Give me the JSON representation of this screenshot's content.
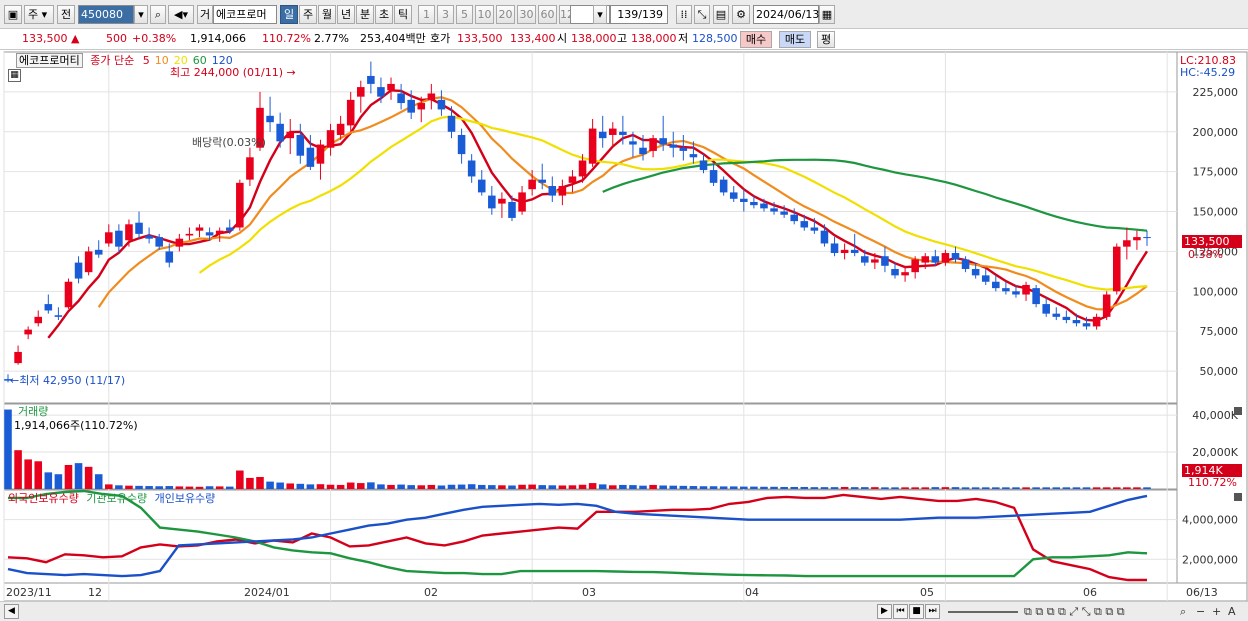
{
  "toolbar": {
    "market_label": "주",
    "period_label": "전",
    "code": "450080",
    "name_btn": "거",
    "stock_name": "에코프로머",
    "period_tabs": [
      "일",
      "주",
      "월",
      "년",
      "분",
      "초",
      "틱"
    ],
    "selected_tab": "일",
    "interval_buttons": [
      "1",
      "3",
      "5",
      "10",
      "20",
      "30",
      "60",
      "120"
    ],
    "count_value": "139/139",
    "date_value": "2024/06/13"
  },
  "quote": {
    "price": "133,500",
    "change": "500",
    "change_pct": "+0.38%",
    "volume": "1,914,066",
    "volume_ratio": "110.72%",
    "turnover_pct": "2.77%",
    "amount": "253,404백만",
    "bid_label": "호가",
    "ask": "133,500",
    "bid": "133,400",
    "open_label": "시",
    "open": "138,000",
    "high_label": "고",
    "high": "138,000",
    "low_label": "저",
    "low": "128,500",
    "buy_btn": "매수",
    "sell_btn": "매도",
    "eval_btn": "평"
  },
  "legend": {
    "stock_name": "에코프로머티",
    "ma_label": "종가 단순",
    "ma_periods": [
      "5",
      "10",
      "20",
      "60",
      "120"
    ],
    "ma_colors": [
      "#d4001a",
      "#f08c1e",
      "#f0e000",
      "#1e9640",
      "#1a50c8"
    ],
    "high_annot": "최고 244,000 (01/11)",
    "low_annot": "최저 42,950 (11/17)",
    "div_annot": "배당락(0.03%)",
    "lc_label": "LC:210.83",
    "hc_label": "HC:-45.29",
    "last_price_tag": "133,500",
    "last_pct_tag": "0.38%",
    "volume_title": "거래량",
    "volume_annot": "1,914,066주(110.72%)",
    "volume_tag": "1,914K",
    "volume_pct_tag": "110.72%",
    "holding_series": [
      "외국인보유수량",
      "기관보유수량",
      "개인보유수량"
    ]
  },
  "chart_data": [
    {
      "type": "candlestick",
      "title": "에코프로머티",
      "yticks": [
        50000,
        75000,
        100000,
        125000,
        150000,
        175000,
        200000,
        225000
      ],
      "ylim": [
        30000,
        250000
      ],
      "xticks": [
        "2023/11",
        "12",
        "2024/01",
        "02",
        "03",
        "04",
        "05",
        "06",
        "06/13"
      ],
      "grid": true,
      "price_ohlc_1": [
        [
          45000,
          48000,
          42950,
          44000
        ],
        [
          55000,
          66000,
          54000,
          62000
        ],
        [
          73000,
          78000,
          70000,
          76000
        ],
        [
          80000,
          88000,
          78000,
          84000
        ],
        [
          92000,
          98000,
          86000,
          88000
        ],
        [
          85000,
          90000,
          82000,
          84000
        ],
        [
          90000,
          108000,
          89000,
          106000
        ],
        [
          118000,
          122000,
          105000,
          108000
        ],
        [
          112000,
          128000,
          110000,
          125000
        ],
        [
          126000,
          132000,
          121000,
          123000
        ],
        [
          130000,
          142000,
          128000,
          137000
        ],
        [
          138000,
          142000,
          124000,
          128000
        ],
        [
          132000,
          145000,
          128000,
          142000
        ],
        [
          143000,
          150000,
          133000,
          136000
        ],
        [
          135000,
          140000,
          130000,
          133000
        ],
        [
          134000,
          136000,
          126000,
          128000
        ],
        [
          125000,
          130000,
          115000,
          118000
        ],
        [
          128000,
          136000,
          125000,
          133000
        ],
        [
          135000,
          140000,
          132000,
          136000
        ],
        [
          138000,
          142000,
          134000,
          140000
        ],
        [
          137000,
          140000,
          132000,
          135000
        ],
        [
          136000,
          140000,
          131000,
          138000
        ],
        [
          140000,
          145000,
          136000,
          138000
        ],
        [
          140000,
          170000,
          138000,
          168000
        ],
        [
          170000,
          190000,
          166000,
          184000
        ],
        [
          190000,
          225000,
          188000,
          215000
        ],
        [
          210000,
          222000,
          200000,
          206000
        ],
        [
          205000,
          212000,
          190000,
          194000
        ],
        [
          196000,
          208000,
          186000,
          200000
        ],
        [
          198000,
          205000,
          180000,
          185000
        ],
        [
          190000,
          198000,
          176000,
          178000
        ],
        [
          180000,
          195000,
          170000,
          192000
        ],
        [
          190000,
          205000,
          185000,
          201000
        ],
        [
          198000,
          210000,
          195000,
          205000
        ],
        [
          204000,
          225000,
          200000,
          220000
        ],
        [
          222000,
          232000,
          212000,
          228000
        ],
        [
          235000,
          244000,
          224000,
          230000
        ],
        [
          228000,
          234000,
          218000,
          222000
        ],
        [
          226000,
          234000,
          220000,
          230000
        ],
        [
          224000,
          230000,
          214000,
          218000
        ],
        [
          220000,
          226000,
          208000,
          212000
        ],
        [
          214000,
          222000,
          206000,
          218000
        ],
        [
          220000,
          230000,
          214000,
          224000
        ],
        [
          220000,
          226000,
          210000,
          214000
        ],
        [
          210000,
          216000,
          196000,
          200000
        ],
        [
          198000,
          202000,
          180000,
          186000
        ],
        [
          182000,
          186000,
          168000,
          172000
        ],
        [
          170000,
          176000,
          160000,
          162000
        ],
        [
          160000,
          166000,
          148000,
          152000
        ],
        [
          155000,
          162000,
          146000,
          158000
        ],
        [
          156000,
          160000,
          144000,
          146000
        ],
        [
          150000,
          166000,
          148000,
          162000
        ],
        [
          164000,
          176000,
          160000,
          170000
        ],
        [
          170000,
          180000,
          164000,
          168000
        ],
        [
          166000,
          172000,
          156000,
          160000
        ],
        [
          160000,
          170000,
          154000,
          166000
        ],
        [
          168000,
          176000,
          162000,
          172000
        ],
        [
          172000,
          186000,
          168000,
          182000
        ],
        [
          180000,
          208000,
          178000,
          202000
        ],
        [
          200000,
          210000,
          190000,
          196000
        ],
        [
          198000,
          206000,
          190000,
          202000
        ]
      ],
      "price_ohlc_2": [
        [
          200000,
          210000,
          192000,
          198000
        ],
        [
          194000,
          200000,
          184000,
          192000
        ],
        [
          190000,
          198000,
          182000,
          186000
        ],
        [
          188000,
          198000,
          184000,
          196000
        ],
        [
          196000,
          210000,
          188000,
          192000
        ],
        [
          192000,
          200000,
          184000,
          190000
        ],
        [
          190000,
          198000,
          182000,
          188000
        ],
        [
          186000,
          194000,
          180000,
          184000
        ],
        [
          182000,
          186000,
          174000,
          176000
        ],
        [
          176000,
          180000,
          166000,
          168000
        ],
        [
          170000,
          172000,
          160000,
          162000
        ],
        [
          162000,
          166000,
          156000,
          158000
        ],
        [
          158000,
          164000,
          150000,
          156000
        ],
        [
          156000,
          160000,
          152000,
          154000
        ],
        [
          155000,
          158000,
          150000,
          152000
        ],
        [
          152000,
          156000,
          148000,
          150000
        ],
        [
          150000,
          154000,
          146000,
          148000
        ],
        [
          148000,
          152000,
          142000,
          144000
        ],
        [
          144000,
          148000,
          138000,
          140000
        ],
        [
          140000,
          146000,
          136000,
          138000
        ],
        [
          138000,
          142000,
          128000,
          130000
        ],
        [
          130000,
          134000,
          122000,
          124000
        ],
        [
          124000,
          130000,
          120000,
          126000
        ],
        [
          126000,
          136000,
          122000,
          124000
        ],
        [
          122000,
          126000,
          116000,
          118000
        ],
        [
          118000,
          124000,
          114000,
          120000
        ],
        [
          122000,
          128000,
          112000,
          116000
        ],
        [
          114000,
          118000,
          108000,
          110000
        ],
        [
          110000,
          116000,
          106000,
          112000
        ],
        [
          112000,
          122000,
          108000,
          120000
        ],
        [
          118000,
          124000,
          114000,
          122000
        ],
        [
          122000,
          126000,
          116000,
          118000
        ],
        [
          118000,
          126000,
          116000,
          124000
        ],
        [
          124000,
          128000,
          118000,
          120000
        ],
        [
          120000,
          122000,
          112000,
          114000
        ],
        [
          114000,
          118000,
          108000,
          110000
        ],
        [
          110000,
          114000,
          104000,
          106000
        ],
        [
          106000,
          110000,
          100000,
          102000
        ],
        [
          102000,
          106000,
          98000,
          100000
        ],
        [
          100000,
          104000,
          96000,
          98000
        ],
        [
          98000,
          106000,
          94000,
          104000
        ],
        [
          102000,
          104000,
          90000,
          92000
        ],
        [
          92000,
          96000,
          84000,
          86000
        ],
        [
          86000,
          90000,
          82000,
          84000
        ],
        [
          84000,
          88000,
          80000,
          82000
        ],
        [
          82000,
          86000,
          78000,
          80000
        ],
        [
          80000,
          84000,
          76000,
          78000
        ],
        [
          78000,
          86000,
          76000,
          84000
        ],
        [
          84000,
          100000,
          82000,
          98000
        ],
        [
          100000,
          130000,
          98000,
          128000
        ],
        [
          128000,
          140000,
          120000,
          132000
        ],
        [
          132000,
          138000,
          126000,
          134000
        ],
        [
          134000,
          138000,
          128500,
          133500
        ]
      ],
      "series": [
        {
          "name": "5",
          "color": "#d4001a"
        },
        {
          "name": "10",
          "color": "#f08c1e"
        },
        {
          "name": "20",
          "color": "#f0e000"
        },
        {
          "name": "60",
          "color": "#1e9640"
        },
        {
          "name": "120",
          "color": "#1a50c8"
        }
      ]
    },
    {
      "type": "bar",
      "title": "거래량",
      "yticks": [
        "40,000K",
        "20,000K"
      ],
      "ylim": [
        0,
        46000
      ],
      "values": [
        43000,
        21000,
        16000,
        15000,
        9000,
        8000,
        13000,
        14000,
        12000,
        8000,
        2500,
        2000,
        1800,
        1700,
        1600,
        1500,
        1600,
        1400,
        1300,
        1200,
        1500,
        1400,
        1300,
        10000,
        6000,
        6500,
        4000,
        3500,
        3000,
        2800,
        2500,
        2600,
        2300,
        2200,
        3500,
        3200,
        3600,
        2500,
        2200,
        2400,
        2100,
        2000,
        2200,
        1900,
        2300,
        2400,
        2600,
        2200,
        2100,
        2000,
        1900,
        2300,
        2400,
        2100,
        2000,
        1900,
        2000,
        2300,
        3200,
        2500,
        2000,
        2200,
        2100,
        1800,
        2200,
        1900,
        1800,
        1700,
        1600,
        1500,
        1500,
        1400,
        1400,
        1300,
        1300,
        1200,
        1200,
        1100,
        1100,
        1100,
        1000,
        1000,
        1000,
        1100,
        1000,
        1000,
        1000,
        900,
        900,
        900,
        900,
        900,
        1000,
        1000,
        1000,
        900,
        900,
        900,
        900,
        900,
        900,
        900,
        900,
        900,
        900,
        900,
        900,
        900,
        900,
        900,
        900,
        900,
        900,
        900,
        900,
        900,
        900,
        900,
        900,
        900,
        900,
        900,
        900,
        900,
        900,
        900,
        900,
        900,
        900,
        900,
        3500,
        900,
        900,
        900,
        900,
        2500,
        5500,
        8500,
        4000,
        2500,
        1914
      ]
    },
    {
      "type": "line",
      "title": "외국인/기관/개인 보유수량",
      "yticks": [
        "4,000,000",
        "2,000,000"
      ],
      "ylim": [
        800000,
        5500000
      ],
      "series": [
        {
          "name": "외국인보유수량",
          "color": "#d4001a",
          "values": [
            2100000,
            2050000,
            1850000,
            2250000,
            2200000,
            2100000,
            2150000,
            2600000,
            2750000,
            2650000,
            2700000,
            2900000,
            3000000,
            2800000,
            2950000,
            2850000,
            3300000,
            3100000,
            2650000,
            2700000,
            2900000,
            3100000,
            2800000,
            2700000,
            2900000,
            3200000,
            3300000,
            3400000,
            3500000,
            3600000,
            3550000,
            4400000,
            4400000,
            4400000,
            4450000,
            4500000,
            4500000,
            4550000,
            4800000,
            4900000,
            5100000,
            5150000,
            5100000,
            5100000,
            5250000,
            5150000,
            5050000,
            5150000,
            5050000,
            4950000,
            4950000,
            5050000,
            4900000,
            4600000,
            2500000,
            1900000,
            1700000,
            1500000,
            1100000,
            950000,
            950000
          ]
        },
        {
          "name": "기관보유수량",
          "color": "#1e9640",
          "values": [
            5100000,
            5100000,
            5300000,
            5400000,
            5450000,
            5300000,
            5200000,
            4600000,
            3600000,
            3500000,
            3400000,
            3250000,
            3100000,
            2900000,
            2600000,
            2450000,
            2350000,
            2300000,
            2050000,
            1850000,
            1600000,
            1400000,
            1350000,
            1300000,
            1300000,
            1250000,
            1250000,
            1400000,
            1400000,
            1400000,
            1400000,
            1400000,
            1380000,
            1360000,
            1350000,
            1320000,
            1280000,
            1250000,
            1220000,
            1200000,
            1190000,
            1180000,
            1150000,
            1150000,
            1150000,
            1150000,
            1150000,
            1150000,
            1150000,
            1150000,
            1150000,
            1150000,
            1150000,
            1150000,
            2000000,
            2100000,
            2100000,
            2150000,
            2200000,
            2350000,
            2300000
          ]
        },
        {
          "name": "개인보유수량",
          "color": "#1a50c8",
          "values": [
            1500000,
            1300000,
            1250000,
            1200000,
            1250000,
            1200000,
            1150000,
            1200000,
            1400000,
            2700000,
            2750000,
            2800000,
            2850000,
            2900000,
            2950000,
            3000000,
            3100000,
            3300000,
            3500000,
            3700000,
            3800000,
            4000000,
            4100000,
            4300000,
            4500000,
            4650000,
            4700000,
            4750000,
            4800000,
            4750000,
            4800000,
            4700000,
            4400000,
            4300000,
            4250000,
            4200000,
            4150000,
            4100000,
            4050000,
            4000000,
            4000000,
            4000000,
            4000000,
            4000000,
            4000000,
            4000000,
            4000000,
            4000000,
            4050000,
            4100000,
            4100000,
            4100000,
            4150000,
            4200000,
            4250000,
            4300000,
            4350000,
            4400000,
            4700000,
            5000000,
            5200000
          ]
        }
      ]
    }
  ]
}
